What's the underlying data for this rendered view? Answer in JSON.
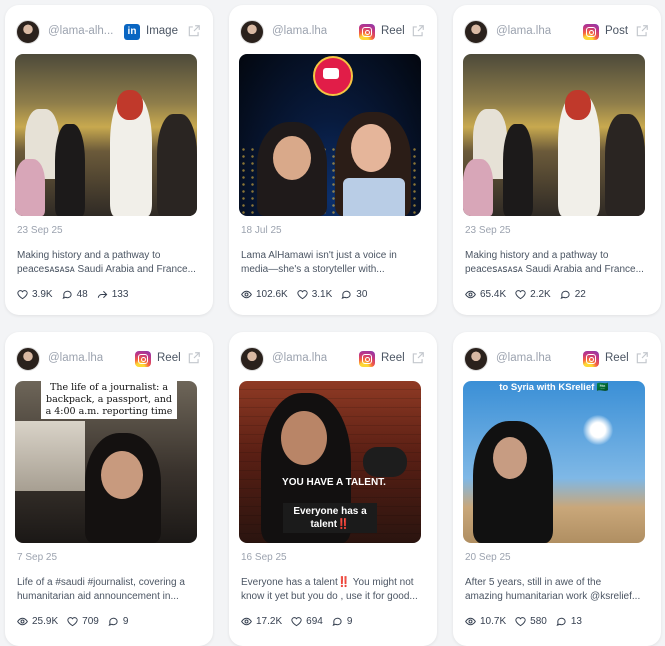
{
  "cards": [
    {
      "handle": "@lama-alh...",
      "platform": {
        "name": "linkedin-icon",
        "label": "Image"
      },
      "date": "23 Sep 25",
      "caption": [
        "Making history and a pathway to",
        "peaceꜱᴀꜱᴀꜱᴀ Saudi Arabia and France..."
      ],
      "stats": [
        {
          "icon": "heart-icon",
          "value": "3.9K"
        },
        {
          "icon": "comment-icon",
          "value": "48"
        },
        {
          "icon": "share-icon",
          "value": "133"
        }
      ]
    },
    {
      "handle": "@lama.lha",
      "platform": {
        "name": "instagram-icon",
        "label": "Reel"
      },
      "date": "18 Jul 25",
      "caption": [
        "Lama AlHamawi isn't just a voice in",
        "media—she's a storyteller with..."
      ],
      "stats": [
        {
          "icon": "eye-icon",
          "value": "102.6K"
        },
        {
          "icon": "heart-icon",
          "value": "3.1K"
        },
        {
          "icon": "comment-icon",
          "value": "30"
        }
      ]
    },
    {
      "handle": "@lama.lha",
      "platform": {
        "name": "instagram-icon",
        "label": "Post"
      },
      "date": "23 Sep 25",
      "caption": [
        "Making history and a pathway to",
        "peaceꜱᴀꜱᴀꜱᴀ Saudi Arabia and France..."
      ],
      "stats": [
        {
          "icon": "eye-icon",
          "value": "65.4K"
        },
        {
          "icon": "heart-icon",
          "value": "2.2K"
        },
        {
          "icon": "comment-icon",
          "value": "22"
        }
      ]
    },
    {
      "handle": "@lama.lha",
      "platform": {
        "name": "instagram-icon",
        "label": "Reel"
      },
      "date": "7 Sep 25",
      "caption": [
        "Life of a #saudi #journalist, covering a",
        "humanitarian aid announcement in..."
      ],
      "overlay": "The life of a journalist: a backpack, a passport, and a 4:00 a.m. reporting time",
      "stats": [
        {
          "icon": "eye-icon",
          "value": "25.9K"
        },
        {
          "icon": "heart-icon",
          "value": "709"
        },
        {
          "icon": "comment-icon",
          "value": "9"
        }
      ]
    },
    {
      "handle": "@lama.lha",
      "platform": {
        "name": "instagram-icon",
        "label": "Reel"
      },
      "date": "16 Sep 25",
      "caption": [
        "Everyone has a talent‼️ You might not",
        "know it yet but you do , use it for good..."
      ],
      "overlay1": "YOU HAVE A TALENT.",
      "overlay2": "Everyone has a talent‼️",
      "stats": [
        {
          "icon": "eye-icon",
          "value": "17.2K"
        },
        {
          "icon": "heart-icon",
          "value": "694"
        },
        {
          "icon": "comment-icon",
          "value": "9"
        }
      ]
    },
    {
      "handle": "@lama.lha",
      "platform": {
        "name": "instagram-icon",
        "label": "Reel"
      },
      "date": "20 Sep 25",
      "caption": [
        "After 5 years, still in awe of the",
        "amazing humanitarian work @ksrelief..."
      ],
      "overlay": "to Syria with KSrelief 🇸🇦",
      "stats": [
        {
          "icon": "eye-icon",
          "value": "10.7K"
        },
        {
          "icon": "heart-icon",
          "value": "580"
        },
        {
          "icon": "comment-icon",
          "value": "13"
        }
      ]
    }
  ]
}
